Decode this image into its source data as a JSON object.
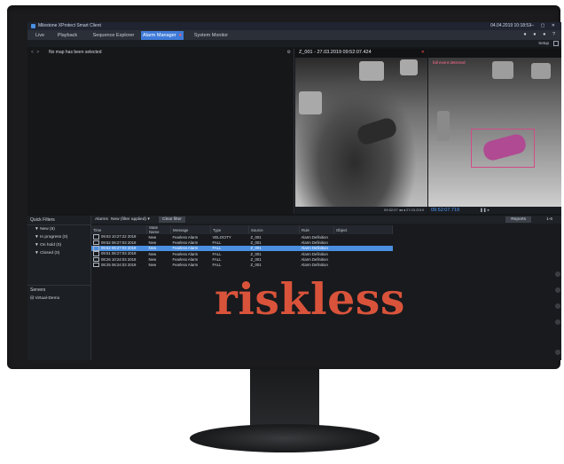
{
  "window": {
    "title": "Milestone XProtect Smart Client",
    "datetime": "04.04.2019 10:18:53",
    "controls": "— ▢ ✕"
  },
  "tabs": [
    {
      "label": "Live"
    },
    {
      "label": "Playback"
    },
    {
      "label": "Sequence Explorer"
    },
    {
      "label": "Alarm Manager",
      "active": true
    },
    {
      "label": "System Monitor"
    }
  ],
  "tab_right_icons": "● ● ● ?",
  "setup_label": "Setup",
  "map": {
    "nav": "< >",
    "message": "No map has been selected"
  },
  "camera1": {
    "title": "Z_001 - 27.03.2019 09:52:07.424",
    "timeline": "09:52:07 ◂◂ ◂ 27.03.2019"
  },
  "camera2": {
    "warning": "fall event detected",
    "time": "09:52:07.719",
    "controls": "❚❚ ▸"
  },
  "quick_filters": {
    "header": "Quick Filters",
    "items": [
      "New (6)",
      "In progress (0)",
      "On hold (0)",
      "Closed (0)"
    ]
  },
  "servers": {
    "header": "Servers",
    "items": [
      "Virtual-Demo"
    ]
  },
  "alarms_bar": {
    "label": "Alarms",
    "filter": "New (filter applied)",
    "clear": "Clear filter",
    "reports": "Reports",
    "page": "1-6"
  },
  "alarms_table": {
    "columns": [
      "Time",
      "State Name",
      "Message",
      "Type",
      "Source",
      "Rule",
      "Object"
    ],
    "rows": [
      [
        "09:53 10:27:22 2019",
        "New",
        "Fearless Alarm",
        "VELOCITY",
        "Z_001",
        "Alarm Definition",
        ""
      ],
      [
        "09:52 06:27:03 2019",
        "New",
        "Fearless Alarm",
        "FALL",
        "Z_001",
        "Alarm Definition",
        ""
      ],
      [
        "09:52 06:27:03 2019",
        "New",
        "Fearless Alarm",
        "FALL",
        "Z_001",
        "Alarm Definition",
        ""
      ],
      [
        "09:51 06:27:03 2019",
        "New",
        "Fearless Alarm",
        "FALL",
        "Z_001",
        "Alarm Definition",
        ""
      ],
      [
        "08:26 10:24:03 2019",
        "New",
        "Fearless Alarm",
        "FALL",
        "Z_001",
        "Alarm Definition",
        ""
      ],
      [
        "08:25 06:24:03 2019",
        "New",
        "Fearless Alarm",
        "FALL",
        "Z_001",
        "Alarm Definition",
        ""
      ]
    ],
    "selected_index": 2
  },
  "brand": "riskless"
}
